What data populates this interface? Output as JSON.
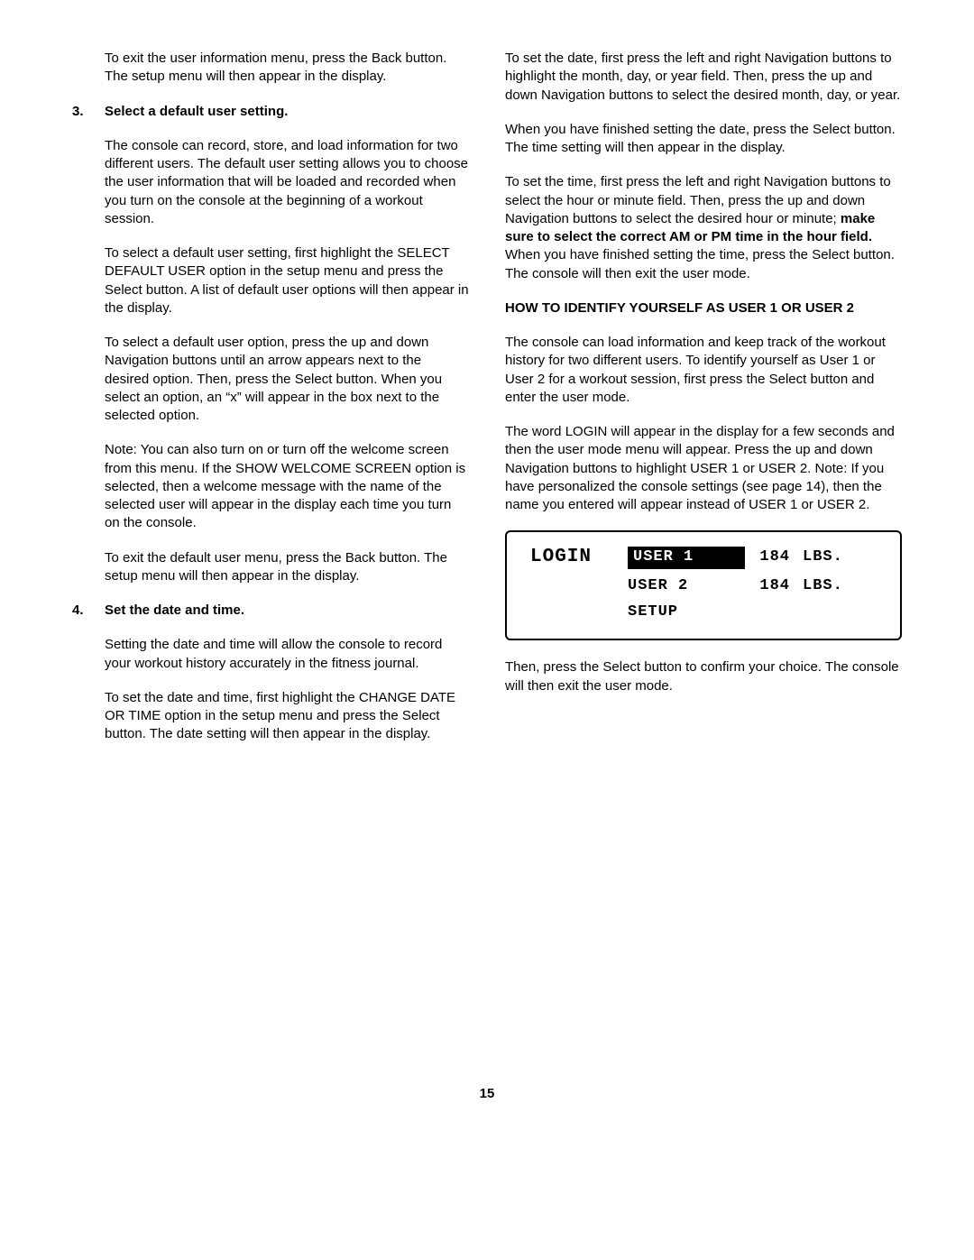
{
  "left": {
    "exit_user_info": "To exit the user information menu, press the Back button. The setup menu will then appear in the display.",
    "item3_num": "3.",
    "item3_head": "Select a default user setting.",
    "item3_p1": "The console can record, store, and load information for two different users. The default user setting allows you to choose the user information that will be loaded and recorded when you turn on the console at the beginning of a workout session.",
    "item3_p2": "To select a default user setting, first highlight the SELECT DEFAULT USER option in the setup menu and press the Select button. A list of default user options will then appear in the display.",
    "item3_p3": "To select a default user option, press the up and down Navigation buttons until an arrow appears next to the desired option. Then, press the Select button. When you select an option, an “x” will appear in the box next to the selected option.",
    "item3_p4": "Note: You can also turn on or turn off the welcome screen from this menu. If the SHOW WELCOME SCREEN option is selected, then a welcome message with the name of the selected user will appear in the display each time you turn on the console.",
    "item3_p5": "To exit the default user menu, press the Back button. The setup menu will then appear in the display.",
    "item4_num": "4.",
    "item4_head": "Set the date and time.",
    "item4_p1": "Setting the date and time will allow the console to record your workout history accurately in the fitness journal.",
    "item4_p2": "To set the date and time, first highlight the CHANGE DATE OR TIME option in the setup menu and press the Select button. The date setting will then appear in the display."
  },
  "right": {
    "date_p1": "To set the date, first press the left and right Navigation buttons to highlight the month, day, or year field. Then, press the up and down Navigation buttons to select the desired month, day, or year.",
    "date_p2": "When you have finished setting the date, press the Select button. The time setting will then appear in the display.",
    "time_p1a": "To set the time, first press the left and right Navigation buttons to select the hour or minute field. Then, press the up and down Navigation buttons to select the desired hour or minute; ",
    "time_p1_bold": "make sure to select the correct AM or PM time in the hour field.",
    "time_p1b": " When you have finished setting the time, press the Select button. The console will then exit the user mode.",
    "section_head": "HOW TO IDENTIFY YOURSELF AS USER 1 OR USER 2",
    "sec_p1": "The console can load information and keep track of the workout history for two different users. To identify yourself as User 1 or User 2 for a workout session, first press the Select button and enter the user mode.",
    "sec_p2": "The word LOGIN will appear in the display for a few seconds and then the user mode menu will appear. Press the up and down Navigation buttons to highlight USER 1 or USER 2. Note: If you have personalized the console settings (see page 14), then the name you entered will appear instead of USER 1 or USER 2.",
    "lcd": {
      "login": "LOGIN",
      "user1": "USER 1",
      "user2": "USER 2",
      "setup": "SETUP",
      "val1": "184",
      "val2": "184",
      "unit": "LBS."
    },
    "sec_p3": "Then, press the Select button to confirm your choice. The console will then exit the user mode."
  },
  "page_number": "15"
}
